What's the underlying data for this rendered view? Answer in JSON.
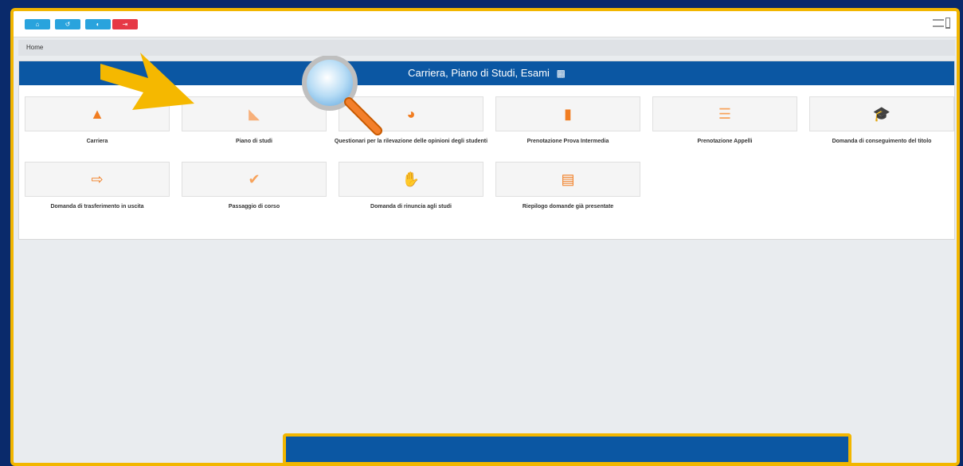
{
  "toolbar": {
    "buttons": [
      {
        "name": "home-button",
        "icon": "home-icon",
        "glyph": "⌂",
        "color": "#29a3dd"
      },
      {
        "name": "back-button",
        "icon": "undo-icon",
        "glyph": "↺",
        "color": "#29a3dd"
      },
      {
        "name": "switch-button",
        "icon": "toggle-icon",
        "glyph": "◐",
        "color": "#29a3dd"
      },
      {
        "name": "logout-button",
        "icon": "logout-icon",
        "glyph": "⇥",
        "color": "#e63946"
      }
    ]
  },
  "breadcrumb": {
    "home": "Home"
  },
  "panel": {
    "title": "Carriera, Piano di Studi, Esami",
    "title_icon": "graduate-icon"
  },
  "tiles": [
    {
      "label": "Carriera",
      "icon": "road-icon",
      "glyph": "▲"
    },
    {
      "label": "Piano di studi",
      "icon": "ruler-icon",
      "glyph": "◣"
    },
    {
      "label": "Questionari per la rilevazione delle opinioni degli studenti",
      "icon": "pie-chart-icon",
      "glyph": "◕"
    },
    {
      "label": "Prenotazione Prova Intermedia",
      "icon": "bookmark-icon",
      "glyph": "▮"
    },
    {
      "label": "Prenotazione Appelli",
      "icon": "checklist-icon",
      "glyph": "☰"
    },
    {
      "label": "Domanda di conseguimento del titolo",
      "icon": "graduation-cap-icon",
      "glyph": "🎓"
    },
    {
      "label": "Domanda di trasferimento in uscita",
      "icon": "sign-out-icon",
      "glyph": "⇨"
    },
    {
      "label": "Passaggio di corso",
      "icon": "double-check-icon",
      "glyph": "✔"
    },
    {
      "label": "Domanda di rinuncia agli studi",
      "icon": "hand-icon",
      "glyph": "✋"
    },
    {
      "label": "Riepilogo domande già presentate",
      "icon": "list-icon",
      "glyph": "▤"
    }
  ],
  "colors": {
    "accent": "#0b57a3",
    "tile_icon": "#f17d21",
    "frame": "#f2b600"
  }
}
